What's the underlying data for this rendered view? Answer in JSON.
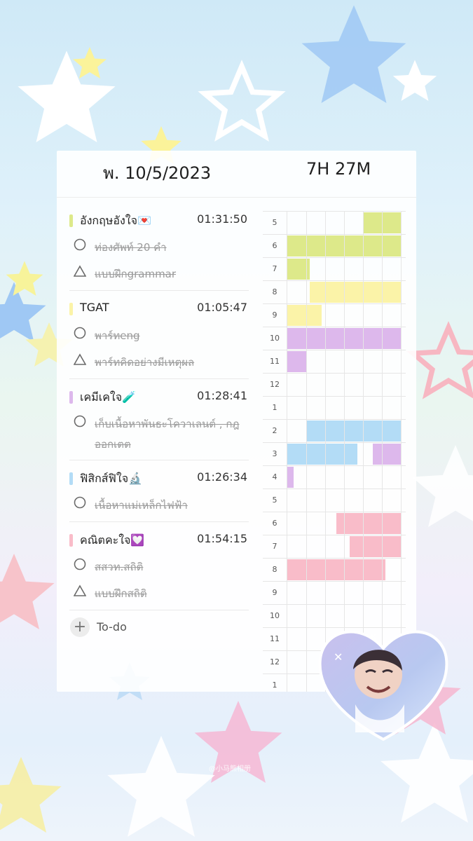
{
  "header": {
    "date": "พ. 10/5/2023",
    "total_time": "7H 27M"
  },
  "subjects": [
    {
      "name": "อังกฤษอังใจ💌",
      "time": "01:31:50",
      "color": "#dde98a",
      "tasks": [
        {
          "icon": "circle-icon",
          "text": "ท่องศัพท์ 20 คำ"
        },
        {
          "icon": "triangle-icon",
          "text": "แบบฝึกgrammar"
        }
      ]
    },
    {
      "name": "TGAT",
      "time": "01:05:47",
      "color": "#fbf3a8",
      "tasks": [
        {
          "icon": "circle-icon",
          "text": "พาร์ทeng"
        },
        {
          "icon": "triangle-icon",
          "text": "พาร์ทคิดอย่างมีเหตุผล"
        }
      ]
    },
    {
      "name": "เคมีเคใจ🧪",
      "time": "01:28:41",
      "color": "#ddb8ec",
      "tasks": [
        {
          "icon": "circle-icon",
          "text": "เก็บเนื้อหาพันธะโควาเลนต์ , กฎออกเตต"
        }
      ]
    },
    {
      "name": "ฟิสิกส์ฟิใจ🔬",
      "time": "01:26:34",
      "color": "#b3dcf6",
      "tasks": [
        {
          "icon": "circle-icon",
          "text": "เนื้อหาแม่เหล็กไฟฟ้า"
        }
      ]
    },
    {
      "name": "คณิตคะใจ💟",
      "time": "01:54:15",
      "color": "#f9bcc9",
      "tasks": [
        {
          "icon": "circle-icon",
          "text": "สสวท.สถิติ"
        },
        {
          "icon": "triangle-icon",
          "text": "แบบฝึกสถิติ"
        }
      ]
    }
  ],
  "todo": {
    "label": "To-do",
    "icon": "plus-icon"
  },
  "timetable": {
    "rows": [
      {
        "hour": "5",
        "segments": [
          {
            "start": 4,
            "end": 6,
            "color": "#dde98a"
          }
        ]
      },
      {
        "hour": "6",
        "segments": [
          {
            "start": 0,
            "end": 6,
            "color": "#dde98a"
          }
        ]
      },
      {
        "hour": "7",
        "segments": [
          {
            "start": 0,
            "end": 1.2,
            "color": "#dde98a"
          }
        ]
      },
      {
        "hour": "8",
        "segments": [
          {
            "start": 1.2,
            "end": 6,
            "color": "#fbf3a8"
          }
        ]
      },
      {
        "hour": "9",
        "segments": [
          {
            "start": 0,
            "end": 1.8,
            "color": "#fbf3a8"
          }
        ]
      },
      {
        "hour": "10",
        "segments": [
          {
            "start": 0,
            "end": 6,
            "color": "#ddb8ec"
          }
        ]
      },
      {
        "hour": "11",
        "segments": [
          {
            "start": 0,
            "end": 1,
            "color": "#ddb8ec"
          }
        ]
      },
      {
        "hour": "12",
        "segments": []
      },
      {
        "hour": "1",
        "segments": []
      },
      {
        "hour": "2",
        "segments": [
          {
            "start": 1,
            "end": 6,
            "color": "#b3dcf6"
          }
        ]
      },
      {
        "hour": "3",
        "segments": [
          {
            "start": 0,
            "end": 3.7,
            "color": "#b3dcf6"
          },
          {
            "start": 4.5,
            "end": 6,
            "color": "#ddb8ec"
          }
        ]
      },
      {
        "hour": "4",
        "segments": [
          {
            "start": 0,
            "end": 0.35,
            "color": "#ddb8ec"
          }
        ]
      },
      {
        "hour": "5",
        "segments": []
      },
      {
        "hour": "6",
        "segments": [
          {
            "start": 2.6,
            "end": 6,
            "color": "#f9bcc9"
          }
        ]
      },
      {
        "hour": "7",
        "segments": [
          {
            "start": 3.3,
            "end": 6,
            "color": "#f9bcc9"
          }
        ]
      },
      {
        "hour": "8",
        "segments": [
          {
            "start": 0,
            "end": 5.2,
            "color": "#f9bcc9"
          }
        ]
      },
      {
        "hour": "9",
        "segments": []
      },
      {
        "hour": "10",
        "segments": []
      },
      {
        "hour": "11",
        "segments": []
      },
      {
        "hour": "12",
        "segments": []
      },
      {
        "hour": "1",
        "segments": []
      }
    ]
  },
  "watermark": "@小马熊相册"
}
